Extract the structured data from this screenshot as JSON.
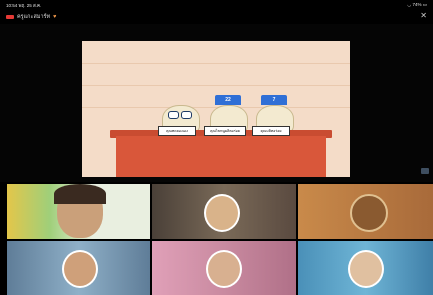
{
  "status": {
    "time": "10:54",
    "date": "พฤ. 25 ส.ค.",
    "battery": "74%"
  },
  "meeting": {
    "title": "ครูแกะสมาร์ท",
    "rec": "rec"
  },
  "slide": {
    "plates": [
      "คุณทดลองเอง",
      "คุณไขหนูผลิตอร่อย",
      "คุณมลิทอร่อย"
    ],
    "hat_numbers": [
      "22",
      "7"
    ]
  },
  "participants": [
    {
      "id": "p1",
      "color": "#9fcf7a"
    },
    {
      "id": "p2",
      "color": "#7a6a58"
    },
    {
      "id": "p3",
      "color": "#c98a4a"
    },
    {
      "id": "p4",
      "color": "#6f8fa8"
    },
    {
      "id": "p5",
      "color": "#c98aa0"
    },
    {
      "id": "p6",
      "color": "#6fb5d6"
    }
  ],
  "icons": {
    "record": "record-icon",
    "close": "close-icon",
    "chat": "chat-icon"
  },
  "pager": "● ● ●"
}
